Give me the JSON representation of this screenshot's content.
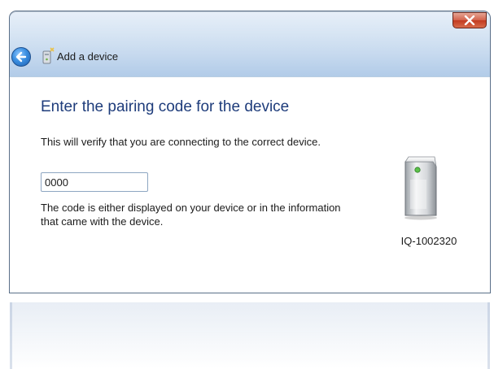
{
  "window": {
    "title": "Add a device"
  },
  "content": {
    "heading": "Enter the pairing code for the device",
    "verify_text": "This will verify that you are connecting to the correct device.",
    "code_input": {
      "value": "0000"
    },
    "hint_text": "The code is either displayed on your device or in the information that came with the device."
  },
  "device": {
    "name": "IQ-1002320",
    "icon": "computer-tower-icon"
  },
  "icons": {
    "back": "back-arrow-icon",
    "title": "add-device-icon",
    "close": "close-icon"
  },
  "colors": {
    "heading": "#1e3c7b",
    "close_button": "#c23a1f",
    "titlebar": "#b4cde9",
    "back_button": "#3a8ee0"
  }
}
